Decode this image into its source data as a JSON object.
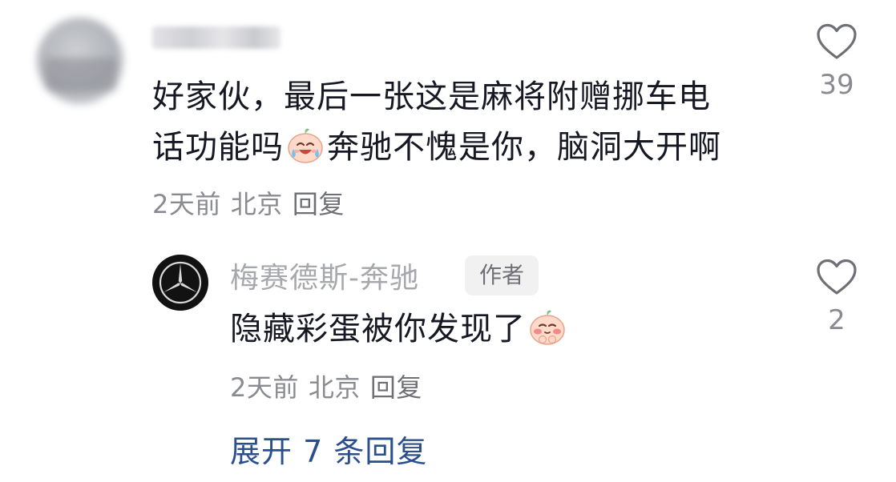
{
  "comment": {
    "text_line1": "好家伙，最后一张这是麻将附赠挪车电",
    "text_line2_a": "话功能吗",
    "emoji_1": "crying-laugh-peach-emoji",
    "text_line2_b": "奔驰不愧是你，脑洞大开啊",
    "time": "2天前",
    "location": "北京",
    "reply_label": "回复",
    "like_count": "39"
  },
  "reply": {
    "author": "梅赛德斯-奔驰",
    "badge": "作者",
    "text": "隐藏彩蛋被你发现了",
    "emoji": "shy-peach-emoji",
    "time": "2天前",
    "location": "北京",
    "reply_label": "回复",
    "like_count": "2"
  },
  "expand_replies": "展开 7 条回复",
  "colors": {
    "text": "#161823",
    "meta": "#8a8b91",
    "link": "#2b4f8a",
    "badge_bg": "#f1f1f2"
  }
}
